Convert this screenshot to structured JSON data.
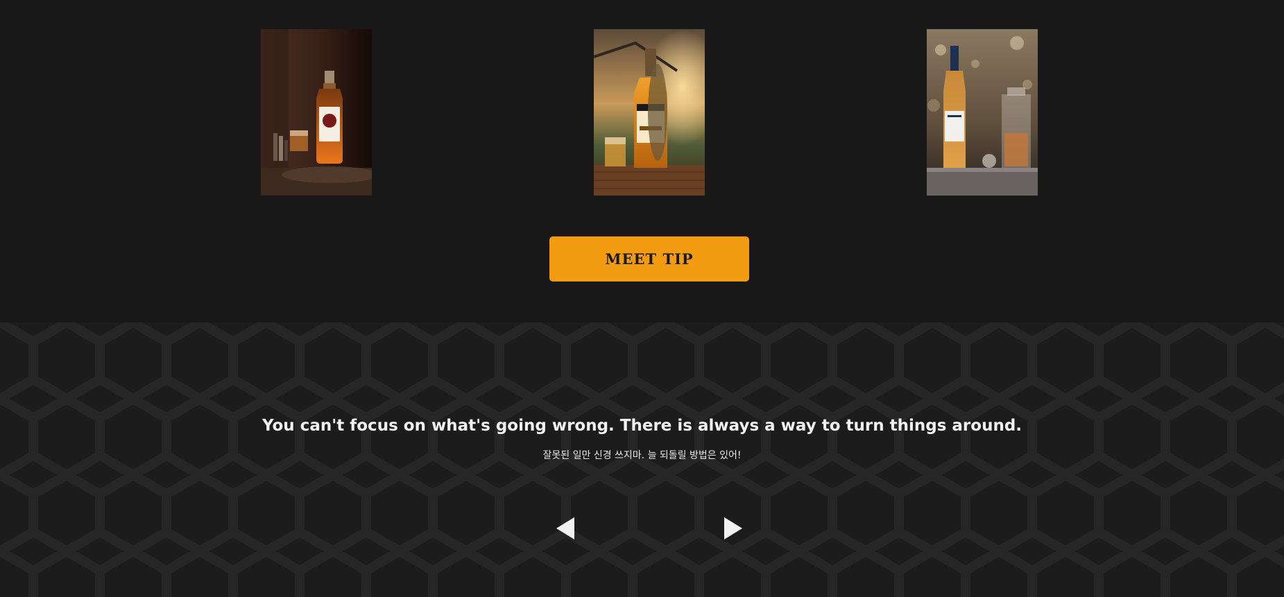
{
  "gallery": {
    "items": [
      {
        "icon": "whiskey-bottle-dark-photo"
      },
      {
        "icon": "honey-whiskey-bottle-photo"
      },
      {
        "icon": "cognac-bottle-bar-photo"
      }
    ]
  },
  "cta": {
    "label": "MEET TIP",
    "color": "#f39c12"
  },
  "quote": {
    "english": "You can't focus on what's going wrong. There is always a way to turn things around.",
    "korean": "잘못된 일만 신경 쓰지마. 늘 되돌릴 방법은 있어!"
  },
  "slider": {
    "prev_icon": "triangle-left-icon",
    "next_icon": "triangle-right-icon"
  },
  "colors": {
    "background": "#181818",
    "accent": "#f39c12",
    "text": "#f2f2f2"
  }
}
